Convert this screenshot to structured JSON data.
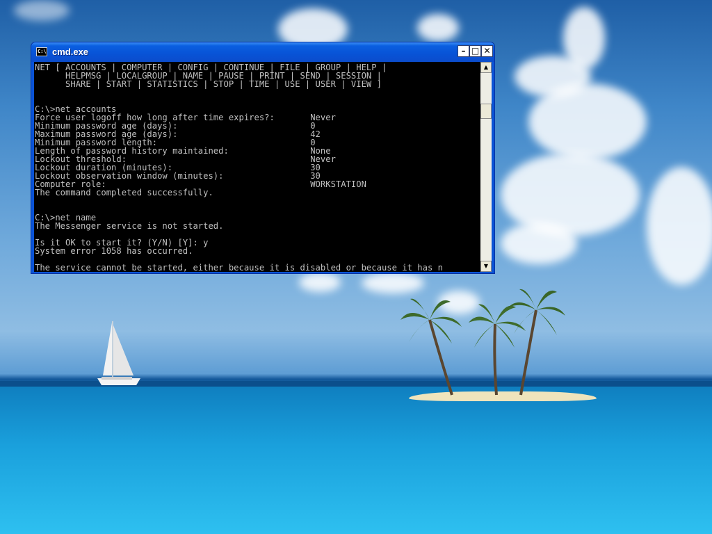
{
  "window": {
    "title": "cmd.exe",
    "icon_label": "C:\\",
    "minimize_glyph": "–",
    "maximize_glyph": "□",
    "close_glyph": "✕"
  },
  "console": {
    "lines": [
      "NET [ ACCOUNTS | COMPUTER | CONFIG | CONTINUE | FILE | GROUP | HELP |",
      "      HELPMSG | LOCALGROUP | NAME | PAUSE | PRINT | SEND | SESSION |",
      "      SHARE | START | STATISTICS | STOP | TIME | USE | USER | VIEW ]",
      "",
      "",
      "C:\\>net accounts",
      "Force user logoff how long after time expires?:       Never",
      "Minimum password age (days):                          0",
      "Maximum password age (days):                          42",
      "Minimum password length:                              0",
      "Length of password history maintained:                None",
      "Lockout threshold:                                    Never",
      "Lockout duration (minutes):                           30",
      "Lockout observation window (minutes):                 30",
      "Computer role:                                        WORKSTATION",
      "The command completed successfully.",
      "",
      "",
      "C:\\>net name",
      "The Messenger service is not started.",
      "",
      "Is it OK to start it? (Y/N) [Y]: y",
      "System error 1058 has occurred.",
      "",
      "The service cannot be started, either because it is disabled or because it has n"
    ]
  },
  "scrollbar": {
    "up_glyph": "▲",
    "down_glyph": "▼"
  }
}
